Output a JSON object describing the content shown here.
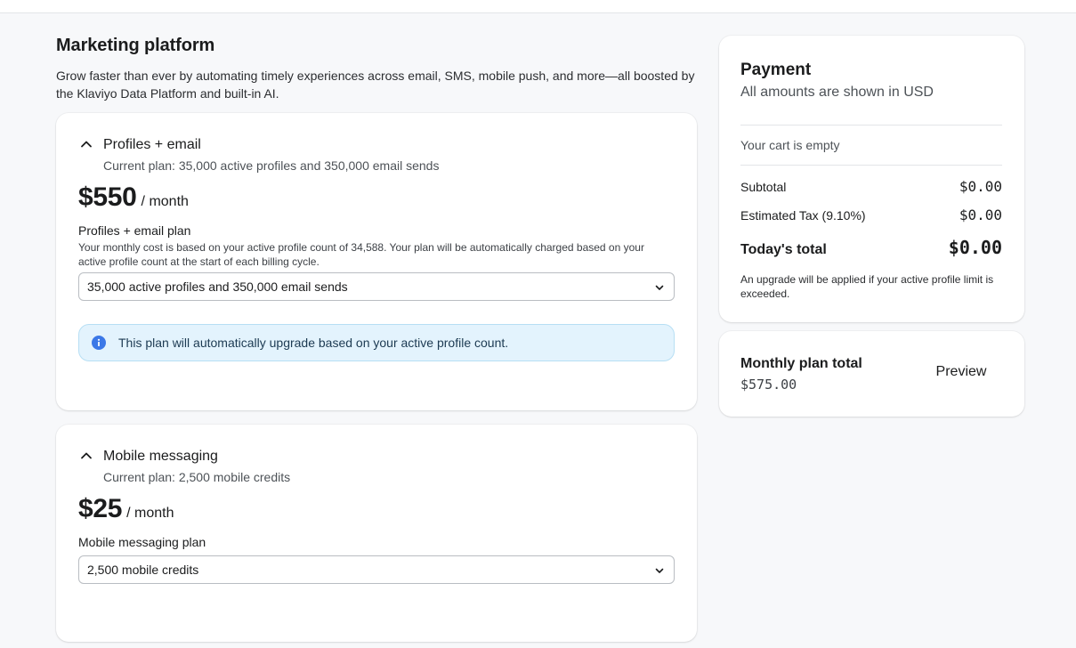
{
  "section": {
    "title": "Marketing platform",
    "description": "Grow faster than ever by automating timely experiences across email, SMS, mobile push, and more—all boosted by the Klaviyo Data Platform and built-in AI."
  },
  "plans": [
    {
      "name": "Profiles + email",
      "current_plan": "Current plan: 35,000 active profiles and 350,000 email sends",
      "price": "$550",
      "per": "/ month",
      "field_label": "Profiles + email plan",
      "field_help": "Your monthly cost is based on your active profile count of 34,588. Your plan will be automatically charged based on your active profile count at the start of each billing cycle.",
      "selected": "35,000 active profiles and 350,000 email sends",
      "info": "This plan will automatically upgrade based on your active profile count."
    },
    {
      "name": "Mobile messaging",
      "current_plan": "Current plan: 2,500 mobile credits",
      "price": "$25",
      "per": "/ month",
      "field_label": "Mobile messaging plan",
      "selected": "2,500 mobile credits"
    }
  ],
  "payment": {
    "title": "Payment",
    "subtitle": "All amounts are shown in USD",
    "cart_empty": "Your cart is empty",
    "subtotal_label": "Subtotal",
    "subtotal_value": "$0.00",
    "tax_label": "Estimated Tax (9.10%)",
    "tax_value": "$0.00",
    "total_label": "Today's total",
    "total_value": "$0.00",
    "note": "An upgrade will be applied if your active profile limit is exceeded."
  },
  "monthly": {
    "title": "Monthly plan total",
    "value": "$575.00",
    "preview_label": "Preview"
  },
  "icons": {
    "collapse": "chevron-up-icon",
    "dropdown": "chevron-down-icon",
    "info": "info-icon"
  },
  "colors": {
    "info_bg": "#e3f3fd",
    "info_icon": "#3b78e7",
    "page_bg": "#f7f8fa"
  }
}
